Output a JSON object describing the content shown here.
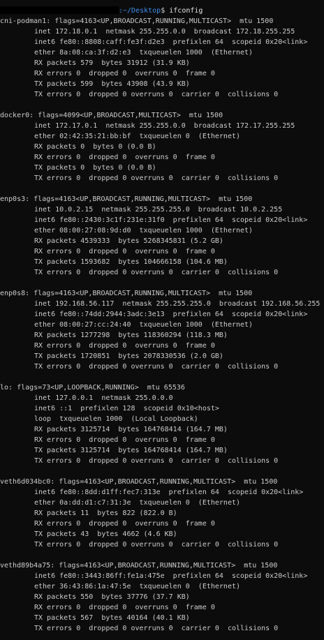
{
  "prompt": {
    "path": ":~/Desktop",
    "symbol": "$ ",
    "command": "ifconfig"
  },
  "interfaces": [
    {
      "header": "cni-podman1: flags=4163<UP,BROADCAST,RUNNING,MULTICAST>  mtu 1500",
      "lines": [
        "inet 172.18.0.1  netmask 255.255.0.0  broadcast 172.18.255.255",
        "inet6 fe80::8808:caff:fe3f:d2e3  prefixlen 64  scopeid 0x20<link>",
        "ether 8a:08:ca:3f:d2:e3  txqueuelen 1000  (Ethernet)",
        "RX packets 579  bytes 31912 (31.9 KB)",
        "RX errors 0  dropped 0  overruns 0  frame 0",
        "TX packets 599  bytes 43908 (43.9 KB)",
        "TX errors 0  dropped 0 overruns 0  carrier 0  collisions 0"
      ]
    },
    {
      "header": "docker0: flags=4099<UP,BROADCAST,MULTICAST>  mtu 1500",
      "lines": [
        "inet 172.17.0.1  netmask 255.255.0.0  broadcast 172.17.255.255",
        "ether 02:42:35:21:bb:bf  txqueuelen 0  (Ethernet)",
        "RX packets 0  bytes 0 (0.0 B)",
        "RX errors 0  dropped 0  overruns 0  frame 0",
        "TX packets 0  bytes 0 (0.0 B)",
        "TX errors 0  dropped 0 overruns 0  carrier 0  collisions 0"
      ]
    },
    {
      "header": "enp0s3: flags=4163<UP,BROADCAST,RUNNING,MULTICAST>  mtu 1500",
      "lines": [
        "inet 10.0.2.15  netmask 255.255.255.0  broadcast 10.0.2.255",
        "inet6 fe80::2430:3c1f:231e:31f0  prefixlen 64  scopeid 0x20<link>",
        "ether 08:00:27:08:9d:d0  txqueuelen 1000  (Ethernet)",
        "RX packets 4539333  bytes 5268345831 (5.2 GB)",
        "RX errors 0  dropped 0  overruns 0  frame 0",
        "TX packets 1593682  bytes 104666158 (104.6 MB)",
        "TX errors 0  dropped 0 overruns 0  carrier 0  collisions 0"
      ]
    },
    {
      "header": "enp0s8: flags=4163<UP,BROADCAST,RUNNING,MULTICAST>  mtu 1500",
      "lines": [
        "inet 192.168.56.117  netmask 255.255.255.0  broadcast 192.168.56.255",
        "inet6 fe80::74dd:2944:3adc:3e13  prefixlen 64  scopeid 0x20<link>",
        "ether 08:00:27:cc:24:40  txqueuelen 1000  (Ethernet)",
        "RX packets 1277298  bytes 118360294 (118.3 MB)",
        "RX errors 0  dropped 0  overruns 0  frame 0",
        "TX packets 1720851  bytes 2078330536 (2.0 GB)",
        "TX errors 0  dropped 0 overruns 0  carrier 0  collisions 0"
      ]
    },
    {
      "header": "lo: flags=73<UP,LOOPBACK,RUNNING>  mtu 65536",
      "lines": [
        "inet 127.0.0.1  netmask 255.0.0.0",
        "inet6 ::1  prefixlen 128  scopeid 0x10<host>",
        "loop  txqueuelen 1000  (Local Loopback)",
        "RX packets 3125714  bytes 164768414 (164.7 MB)",
        "RX errors 0  dropped 0  overruns 0  frame 0",
        "TX packets 3125714  bytes 164768414 (164.7 MB)",
        "TX errors 0  dropped 0 overruns 0  carrier 0  collisions 0"
      ]
    },
    {
      "header": "veth6d034bc0: flags=4163<UP,BROADCAST,RUNNING,MULTICAST>  mtu 1500",
      "lines": [
        "inet6 fe80::8dd:d1ff:fec7:313e  prefixlen 64  scopeid 0x20<link>",
        "ether 0a:dd:d1:c7:31:3e  txqueuelen 0  (Ethernet)",
        "RX packets 11  bytes 822 (822.0 B)",
        "RX errors 0  dropped 0  overruns 0  frame 0",
        "TX packets 43  bytes 4662 (4.6 KB)",
        "TX errors 0  dropped 0 overruns 0  carrier 0  collisions 0"
      ]
    },
    {
      "header": "vethd89b4a75: flags=4163<UP,BROADCAST,RUNNING,MULTICAST>  mtu 1500",
      "lines": [
        "inet6 fe80::3443:86ff:fe1a:475e  prefixlen 64  scopeid 0x20<link>",
        "ether 36:43:86:1a:47:5e  txqueuelen 0  (Ethernet)",
        "RX packets 550  bytes 37776 (37.7 KB)",
        "RX errors 0  dropped 0  overruns 0  frame 0",
        "TX packets 567  bytes 40164 (40.1 KB)",
        "TX errors 0  dropped 0 overruns 0  carrier 0  collisions 0"
      ]
    }
  ]
}
